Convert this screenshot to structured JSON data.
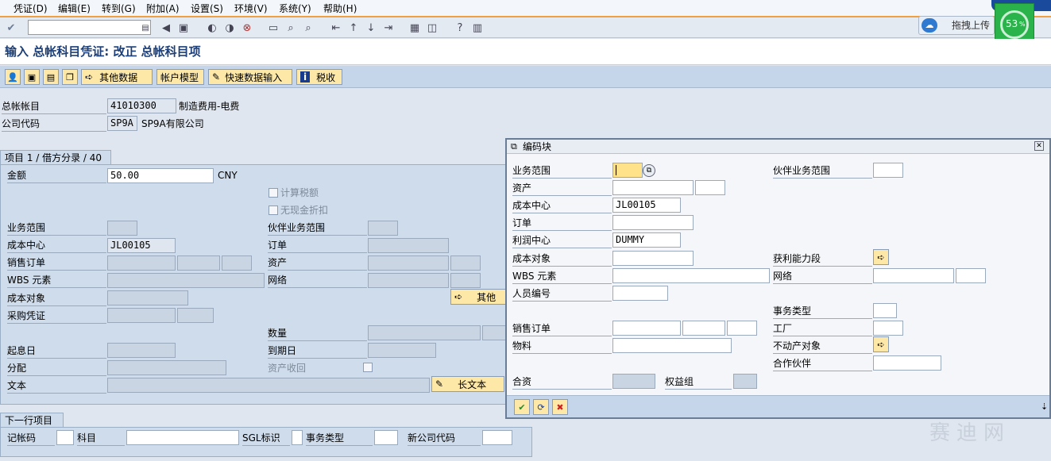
{
  "menu": [
    "凭证(D)",
    "编辑(E)",
    "转到(G)",
    "附加(A)",
    "设置(S)",
    "环境(V)",
    "系统(Y)",
    "帮助(H)"
  ],
  "upload": {
    "label": "拖拽上传",
    "percent": "53",
    "percent_sign": "%"
  },
  "page_title": "输入 总帐科目凭证: 改正 总帐科目项",
  "app_toolbar": {
    "other_data": "其他数据",
    "account_model": "帐户模型",
    "fast_entry": "快速数据输入",
    "tax": "税收"
  },
  "header": {
    "gl_label": "总帐帐目",
    "gl_value": "41010300",
    "gl_desc": "制造费用-电费",
    "co_label": "公司代码",
    "co_value": "SP9A",
    "co_desc": "SP9A有限公司"
  },
  "item": {
    "tab": "项目 1 / 借方分录 / 40",
    "amount_label": "金额",
    "amount_value": "50.00",
    "currency": "CNY",
    "calc_tax": "计算税额",
    "no_cash_disc": "无现金折扣",
    "ba_label": "业务范围",
    "partner_ba_label": "伙伴业务范围",
    "cc_label": "成本中心",
    "cc_value": "JL00105",
    "order_label": "订单",
    "so_label": "销售订单",
    "asset_label": "资产",
    "wbs_label": "WBS 元素",
    "network_label": "网络",
    "co_obj_label": "成本对象",
    "more_btn": "其他",
    "po_label": "采购凭证",
    "qty_label": "数量",
    "value_date_label": "起息日",
    "due_date_label": "到期日",
    "assign_label": "分配",
    "asset_retire_label": "资产收回",
    "text_label": "文本",
    "long_text_btn": "长文本"
  },
  "next_line": {
    "tab": "下一行项目",
    "posting_key": "记帐码",
    "account": "科目",
    "sgl": "SGL标识",
    "trans_type": "事务类型",
    "new_co": "新公司代码"
  },
  "dialog": {
    "title": "编码块",
    "ba": "业务范围",
    "partner_ba": "伙伴业务范围",
    "asset": "资产",
    "cc": "成本中心",
    "cc_value": "JL00105",
    "order": "订单",
    "profit_center": "利润中心",
    "pc_value": "DUMMY",
    "co_obj": "成本对象",
    "profit_seg": "获利能力段",
    "wbs": "WBS 元素",
    "network": "网络",
    "personnel": "人员编号",
    "trans_type": "事务类型",
    "so": "销售订单",
    "plant": "工厂",
    "material": "物料",
    "real_estate": "不动产对象",
    "partner": "合作伙伴",
    "jv": "合资",
    "equity_grp": "权益组"
  },
  "watermark": "赛迪网"
}
